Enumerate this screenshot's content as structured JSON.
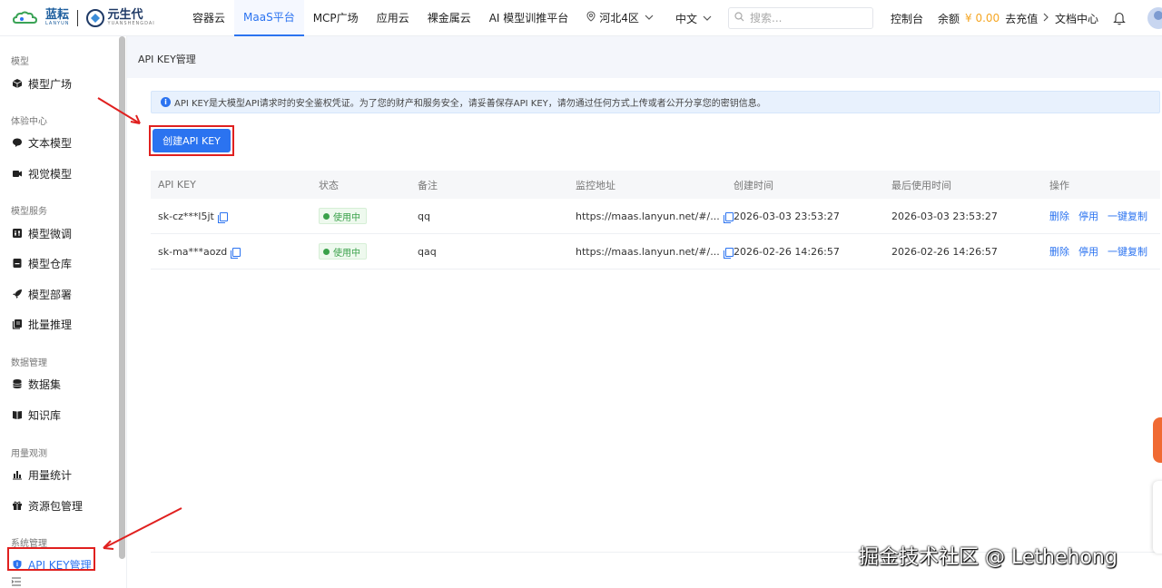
{
  "brand": {
    "logo1_text": "蓝耘",
    "logo1_sub": "LANYUN",
    "logo2_text": "元生代",
    "logo2_sub": "YUANSHENGDAI"
  },
  "nav": {
    "items": [
      "容器云",
      "MaaS平台",
      "MCP广场",
      "应用云",
      "裸金属云",
      "AI 模型训推平台"
    ],
    "active": "MaaS平台",
    "region": "河北4区",
    "language": "中文",
    "search_placeholder": "搜索...",
    "console": "控制台",
    "balance_label": "余额",
    "balance_amount": "¥ 0.00",
    "recharge": "去充值",
    "docs": "文档中心"
  },
  "sidebar": {
    "groups": [
      {
        "title": "模型",
        "items": [
          "模型广场"
        ]
      },
      {
        "title": "体验中心",
        "items": [
          "文本模型",
          "视觉模型"
        ]
      },
      {
        "title": "模型服务",
        "items": [
          "模型微调",
          "模型仓库",
          "模型部署",
          "批量推理"
        ]
      },
      {
        "title": "数据管理",
        "items": [
          "数据集",
          "知识库"
        ]
      },
      {
        "title": "用量观测",
        "items": [
          "用量统计",
          "资源包管理"
        ]
      },
      {
        "title": "系统管理",
        "items": [
          "API KEY管理"
        ]
      }
    ],
    "active": "API KEY管理"
  },
  "page": {
    "title": "API KEY管理",
    "notice": "API KEY是大模型API请求时的安全鉴权凭证。为了您的财产和服务安全，请妥善保存API KEY，请勿通过任何方式上传或者公开分享您的密钥信息。",
    "create_button": "创建API KEY"
  },
  "table": {
    "columns": [
      "API KEY",
      "状态",
      "备注",
      "监控地址",
      "创建时间",
      "最后使用时间",
      "操作"
    ],
    "rows": [
      {
        "key": "sk-cz***l5jt",
        "status": "使用中",
        "remark": "qq",
        "monitor": "https://maas.lanyun.net/#/...",
        "created": "2026-03-03 23:53:27",
        "last_used": "2026-03-03 23:53:27"
      },
      {
        "key": "sk-ma***aozd",
        "status": "使用中",
        "remark": "qaq",
        "monitor": "https://maas.lanyun.net/#/...",
        "created": "2026-02-26 14:26:57",
        "last_used": "2026-02-26 14:26:57"
      }
    ],
    "actions": [
      "删除",
      "停用",
      "一键复制"
    ]
  },
  "watermark": "掘金技术社区 @ Lethehong",
  "colors": {
    "accent": "#2b73f0",
    "highlight_box": "#e0201f",
    "status_green": "#3aa14a",
    "balance_amount": "#f5a623"
  }
}
